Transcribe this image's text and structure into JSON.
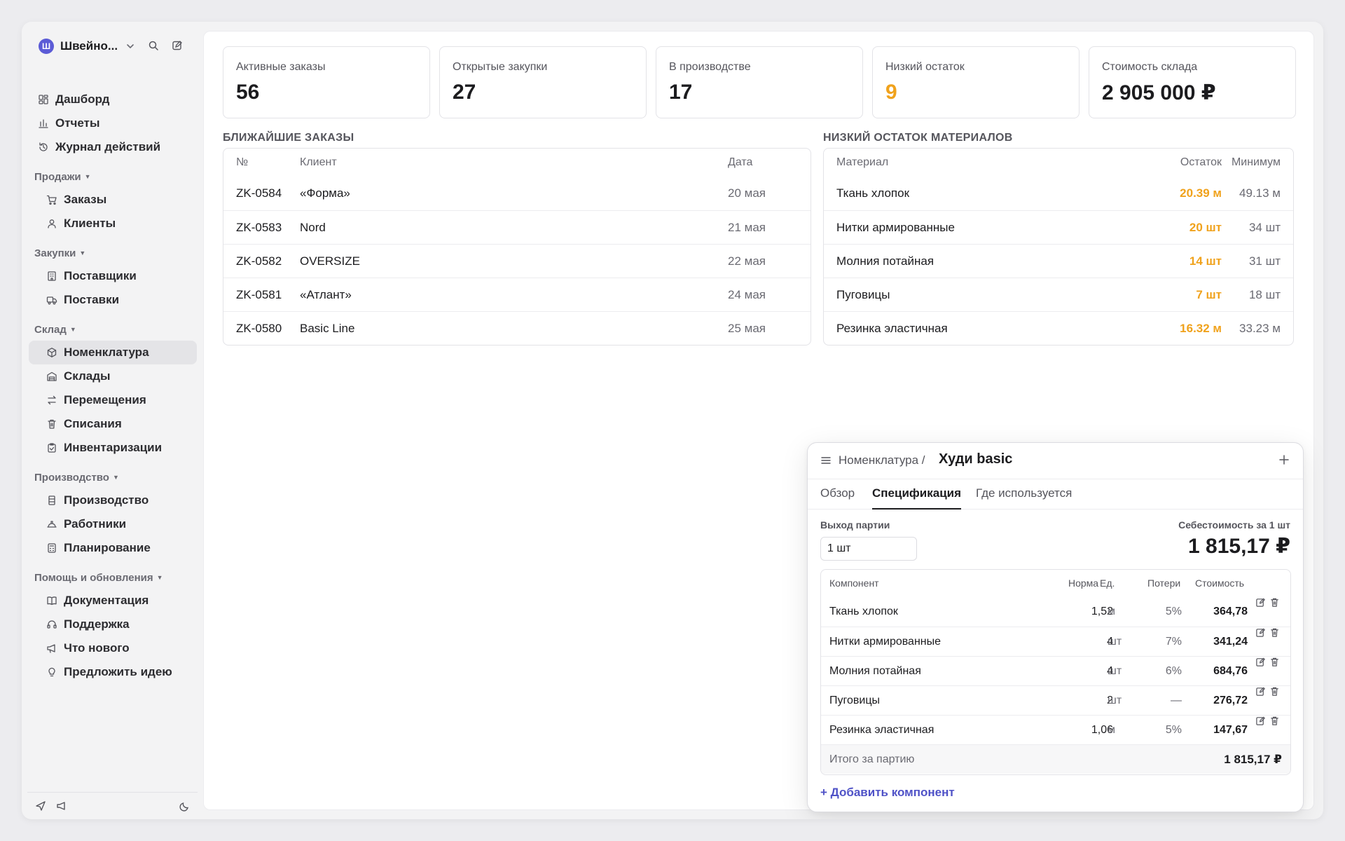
{
  "workspace": {
    "initial": "Ш",
    "name": "Швейно..."
  },
  "sidebar": {
    "top_items": [
      {
        "label": "Дашборд",
        "icon": "dashboard-icon"
      },
      {
        "label": "Отчеты",
        "icon": "bar-chart-icon"
      },
      {
        "label": "Журнал действий",
        "icon": "history-icon"
      }
    ],
    "groups": [
      {
        "title": "Продажи",
        "items": [
          {
            "label": "Заказы",
            "icon": "cart-icon"
          },
          {
            "label": "Клиенты",
            "icon": "user-icon"
          }
        ]
      },
      {
        "title": "Закупки",
        "items": [
          {
            "label": "Поставщики",
            "icon": "building-icon"
          },
          {
            "label": "Поставки",
            "icon": "truck-icon"
          }
        ]
      },
      {
        "title": "Склад",
        "items": [
          {
            "label": "Номенклатура",
            "icon": "box-icon",
            "active": true
          },
          {
            "label": "Склады",
            "icon": "warehouse-icon"
          },
          {
            "label": "Перемещения",
            "icon": "arrows-exchange-icon"
          },
          {
            "label": "Списания",
            "icon": "trash-icon"
          },
          {
            "label": "Инвентаризации",
            "icon": "clipboard-check-icon"
          }
        ]
      },
      {
        "title": "Производство",
        "items": [
          {
            "label": "Производство",
            "icon": "factory-icon"
          },
          {
            "label": "Работники",
            "icon": "helmet-icon"
          },
          {
            "label": "Планирование",
            "icon": "calculator-icon"
          }
        ]
      },
      {
        "title": "Помощь и обновления",
        "items": [
          {
            "label": "Документация",
            "icon": "book-icon"
          },
          {
            "label": "Поддержка",
            "icon": "headset-icon"
          },
          {
            "label": "Что нового",
            "icon": "megaphone-icon"
          },
          {
            "label": "Предложить идею",
            "icon": "lightbulb-icon"
          }
        ]
      }
    ]
  },
  "kpis": [
    {
      "label": "Активные заказы",
      "value": "56"
    },
    {
      "label": "Открытые закупки",
      "value": "27"
    },
    {
      "label": "В производстве",
      "value": "17"
    },
    {
      "label": "Низкий остаток",
      "value": "9",
      "warn": true
    },
    {
      "label": "Стоимость склада",
      "value": "2 905 000 ₽"
    }
  ],
  "orders": {
    "title": "БЛИЖАЙШИЕ ЗАКАЗЫ",
    "columns": [
      "№",
      "Клиент",
      "Дата"
    ],
    "rows": [
      {
        "no": "ZK-0584",
        "client": "«Форма»",
        "date": "20 мая"
      },
      {
        "no": "ZK-0583",
        "client": "Nord",
        "date": "21 мая"
      },
      {
        "no": "ZK-0582",
        "client": "OVERSIZE",
        "date": "22 мая"
      },
      {
        "no": "ZK-0581",
        "client": "«Атлант»",
        "date": "24 мая"
      },
      {
        "no": "ZK-0580",
        "client": "Basic Line",
        "date": "25 мая"
      }
    ]
  },
  "low_stock": {
    "title": "НИЗКИЙ ОСТАТОК МАТЕРИАЛОВ",
    "columns": [
      "Материал",
      "Остаток",
      "Минимум"
    ],
    "rows": [
      {
        "material": "Ткань хлопок",
        "stock": "20.39 м",
        "min": "49.13 м"
      },
      {
        "material": "Нитки армированные",
        "stock": "20 шт",
        "min": "34 шт"
      },
      {
        "material": "Молния потайная",
        "stock": "14 шт",
        "min": "31 шт"
      },
      {
        "material": "Пуговицы",
        "stock": "7 шт",
        "min": "18 шт"
      },
      {
        "material": "Резинка эластичная",
        "stock": "16.32 м",
        "min": "33.23 м"
      }
    ]
  },
  "item_panel": {
    "breadcrumb": "Номенклатура /",
    "title": "Худи basic",
    "tabs": [
      {
        "label": "Обзор"
      },
      {
        "label": "Спецификация",
        "active": true
      },
      {
        "label": "Где используется"
      }
    ],
    "batch_label": "Выход партии",
    "batch_value": "1 шт",
    "unit_cost_label": "Себестоимость за 1 шт",
    "unit_cost_value": "1 815,17 ₽",
    "columns": [
      "Компонент",
      "Норма",
      "Ед.",
      "Потери",
      "Стоимость"
    ],
    "components": [
      {
        "name": "Ткань хлопок",
        "norm": "1,52",
        "unit": "м",
        "loss": "5%",
        "cost": "364,78"
      },
      {
        "name": "Нитки армированные",
        "norm": "4",
        "unit": "шт",
        "loss": "7%",
        "cost": "341,24"
      },
      {
        "name": "Молния потайная",
        "norm": "4",
        "unit": "шт",
        "loss": "6%",
        "cost": "684,76"
      },
      {
        "name": "Пуговицы",
        "norm": "2",
        "unit": "шт",
        "loss": "—",
        "cost": "276,72"
      },
      {
        "name": "Резинка эластичная",
        "norm": "1,06",
        "unit": "м",
        "loss": "5%",
        "cost": "147,67"
      }
    ],
    "total_label": "Итого за партию",
    "total_value": "1 815,17 ₽",
    "add_label": "+ Добавить компонент"
  },
  "colors": {
    "accent": "#5b5bd6",
    "warn": "#f0a21c",
    "link": "#4f52c7"
  }
}
